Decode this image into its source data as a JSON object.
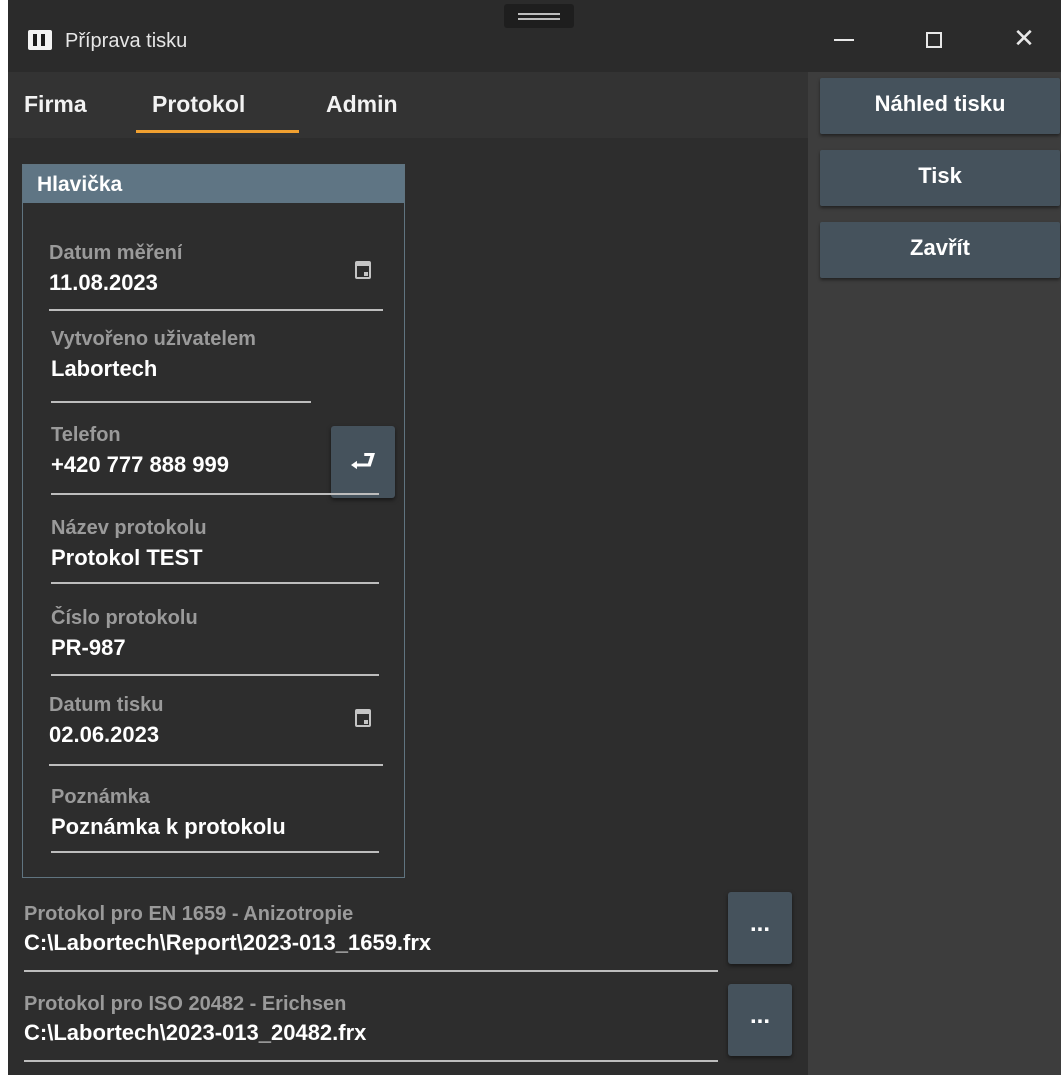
{
  "window": {
    "title": "Příprava tisku",
    "minimize_icon": "minimize-icon",
    "maximize_icon": "maximize-icon",
    "close_icon": "close-icon"
  },
  "tabs": [
    {
      "label": "Firma",
      "active": false
    },
    {
      "label": "Protokol",
      "active": true
    },
    {
      "label": "Admin",
      "active": false
    }
  ],
  "actions": {
    "preview_label": "Náhled tisku",
    "print_label": "Tisk",
    "close_label": "Zavřít"
  },
  "header_group": {
    "title": "Hlavička",
    "fields": [
      {
        "label": "Datum měření",
        "value": "11.08.2023",
        "icon": "calendar-icon"
      },
      {
        "label": "Vytvořeno uživatelem",
        "value": "Labortech",
        "button_icon": "enter-icon"
      },
      {
        "label": "Telefon",
        "value": "+420 777 888 999"
      },
      {
        "label": "Název protokolu",
        "value": "Protokol TEST"
      },
      {
        "label": "Číslo protokolu",
        "value": "PR-987"
      },
      {
        "label": "Datum tisku",
        "value": "02.06.2023",
        "icon": "calendar-icon"
      },
      {
        "label": "Poznámka",
        "value": "Poznámka k protokolu"
      }
    ]
  },
  "report_files": [
    {
      "label": "Protokol pro EN 1659 - Anizotropie",
      "value": "C:\\Labortech\\Report\\2023-013_1659.frx",
      "button": "..."
    },
    {
      "label": "Protokol pro ISO 20482 - Erichsen",
      "value": "C:\\Labortech\\2023-013_20482.frx",
      "button": "..."
    }
  ],
  "colors": {
    "accent": "#f0a030",
    "button": "#45525c",
    "group_header": "#5f7584",
    "background": "#2d2d2d"
  }
}
